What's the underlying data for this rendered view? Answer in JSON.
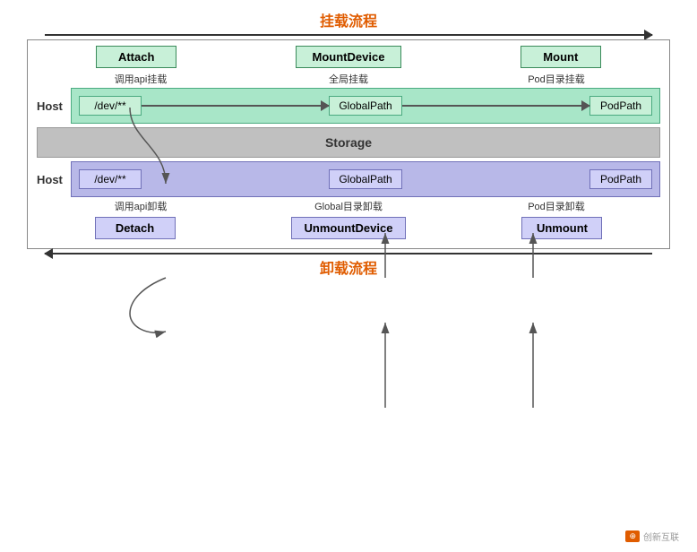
{
  "titles": {
    "top": "挂载流程",
    "bottom": "卸载流程"
  },
  "top_actions": {
    "attach": "Attach",
    "mountDevice": "MountDevice",
    "mount": "Mount"
  },
  "top_labels": {
    "attach": "调用api挂载",
    "mountDevice": "全局挂载",
    "mount": "Pod目录挂载"
  },
  "host_label": "Host",
  "paths": {
    "dev": "/dev/**",
    "globalPath": "GlobalPath",
    "podPath": "PodPath"
  },
  "storage": "Storage",
  "bottom_labels": {
    "detach": "调用api卸载",
    "unmountDevice": "Global目录卸载",
    "unmount": "Pod目录卸载"
  },
  "bottom_actions": {
    "detach": "Detach",
    "unmountDevice": "UnmountDevice",
    "unmount": "Unmount"
  },
  "watermark": {
    "text": "创新互联",
    "logo": "CW"
  }
}
